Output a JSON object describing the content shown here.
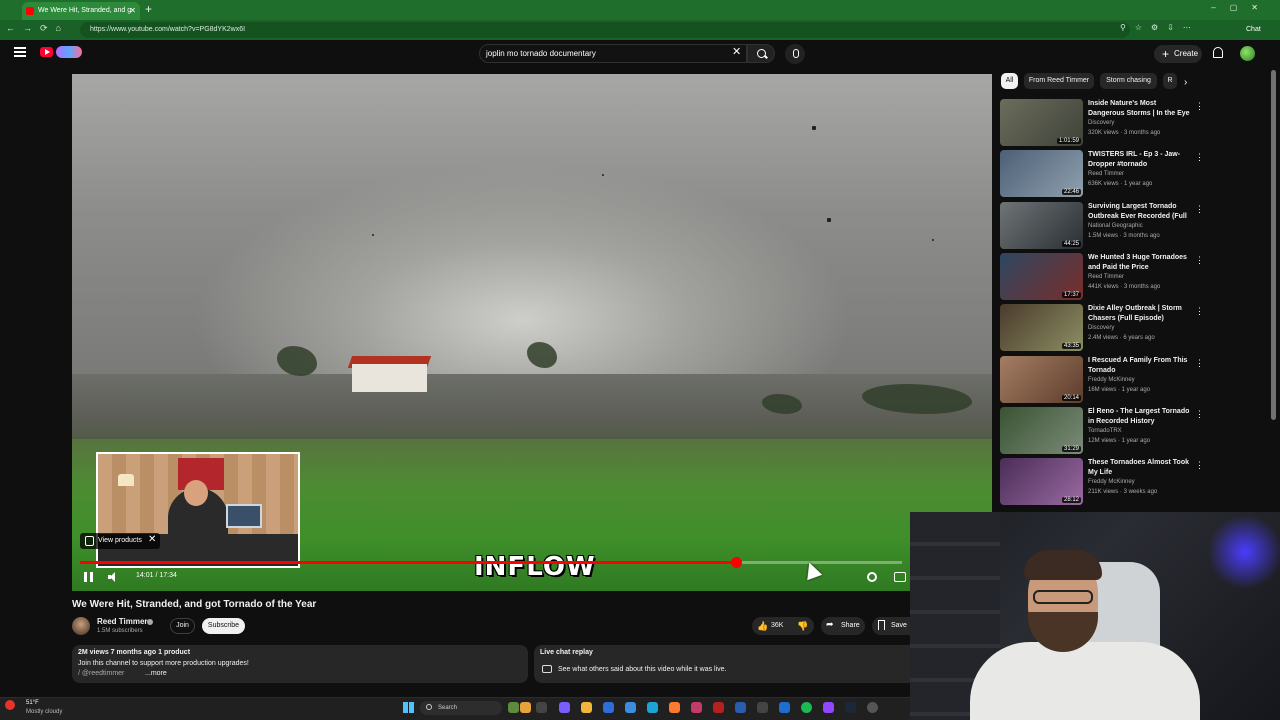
{
  "browser": {
    "tab_title": "We Were Hit, Stranded, and g",
    "url": "https://www.youtube.com/watch?v=PG8dYK2wx6I",
    "chat_label": "Chat"
  },
  "header": {
    "search_query": "joplin mo tornado documentary",
    "create_label": "Create"
  },
  "player": {
    "caption": "INFLOW",
    "time_display": "14:01 / 17:34",
    "progress_fraction": 0.7979,
    "view_products_label": "View products"
  },
  "video": {
    "title": "We Were Hit, Stranded, and got Tornado of the Year",
    "channel": "Reed Timmer",
    "subscribers": "1.5M subscribers",
    "join_label": "Join",
    "subscribe_label": "Subscribe",
    "likes": "36K",
    "share_label": "Share",
    "save_label": "Save",
    "description_stats": "2M views  7 months ago  1 product",
    "description_line": "Join this channel to support more production upgrades!",
    "description_handle": "/ @reedtimmer",
    "description_more": "...more",
    "chat_title": "Live chat replay",
    "chat_desc": "See what others said about this video while it was live."
  },
  "sidebar": {
    "chips": [
      "All",
      "From Reed Timmer",
      "Storm chasing",
      "R"
    ],
    "recommendations": [
      {
        "title": "Inside Nature's Most Dangerous Storms | In the Eye of the Stor...",
        "channel": "Discovery",
        "views": "320K views · 3 months ago",
        "duration": "1:01:59",
        "colors": [
          "#6b6d5c",
          "#3e4238"
        ]
      },
      {
        "title": "TWISTERS IRL - Ep 3 - Jaw-Dropper #tornado",
        "channel": "Reed Timmer",
        "views": "636K views · 1 year ago",
        "duration": "22:46",
        "colors": [
          "#4c6076",
          "#8fa0ae"
        ]
      },
      {
        "title": "Surviving Largest Tornado Outbreak Ever Recorded (Full ...",
        "channel": "National Geographic",
        "views": "1.5M views · 3 months ago",
        "duration": "44:25",
        "colors": [
          "#6f7477",
          "#2a2f33"
        ]
      },
      {
        "title": "We Hunted 3 Huge Tornadoes and Paid the Price",
        "channel": "Reed Timmer",
        "views": "441K views · 3 months ago",
        "duration": "17:37",
        "colors": [
          "#2d4762",
          "#7a2d2a"
        ]
      },
      {
        "title": "Dixie Alley Outbreak | Storm Chasers (Full Episode)",
        "channel": "Discovery",
        "views": "2.4M views · 6 years ago",
        "duration": "43:35",
        "colors": [
          "#4b3b2c",
          "#8b8f63"
        ]
      },
      {
        "title": "I Rescued A Family From This Tornado",
        "channel": "Freddy McKinney",
        "views": "16M views · 1 year ago",
        "duration": "20:14",
        "colors": [
          "#a57e63",
          "#5c3d2c"
        ]
      },
      {
        "title": "El Reno - The Largest Tornado in Recorded History",
        "channel": "TornadoTRX",
        "views": "12M views · 1 year ago",
        "duration": "31:29",
        "colors": [
          "#3a5332",
          "#7b8b78"
        ]
      },
      {
        "title": "These Tornadoes Almost Took My Life",
        "channel": "Freddy McKinney",
        "views": "211K views · 3 weeks ago",
        "duration": "28:12",
        "colors": [
          "#4a2d57",
          "#9a6aa2"
        ]
      }
    ]
  },
  "taskbar": {
    "weather_temp": "51°F",
    "weather_desc": "Mostly cloudy",
    "search_label": "Search"
  }
}
